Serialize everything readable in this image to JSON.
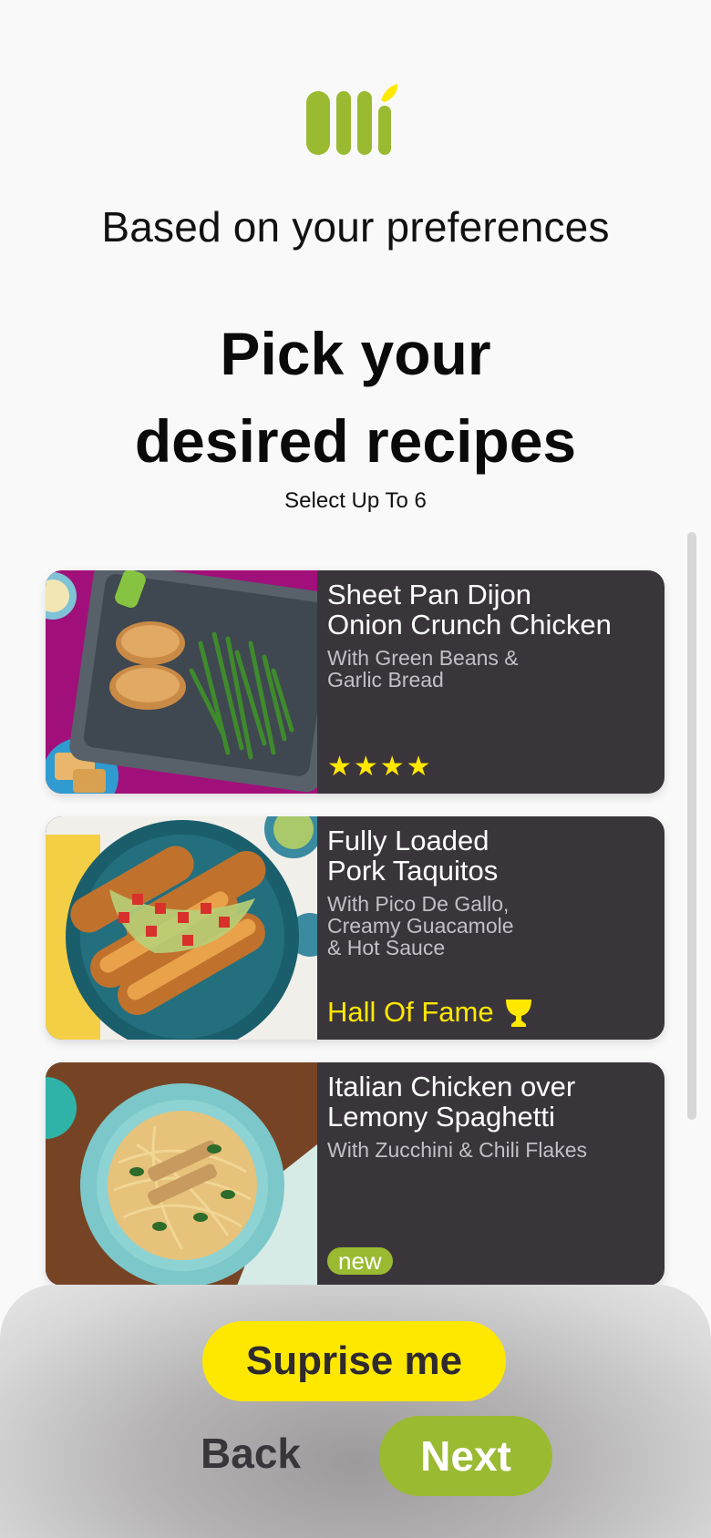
{
  "header": {
    "subtitle": "Based on your preferences",
    "title_line1": "Pick your",
    "title_line2": "desired recipes",
    "hint": "Select Up To 6"
  },
  "recipes": [
    {
      "name": "Sheet Pan Dijon\nOnion Crunch Chicken",
      "description": "With Green Beans &\nGarlic Bread",
      "rating": "★★★★",
      "image_icon": "sheet-pan-chicken-photo"
    },
    {
      "name": "Fully Loaded\nPork Taquitos",
      "description": "With Pico De Gallo,\nCreamy Guacamole\n& Hot Sauce",
      "tag": "Hall Of Fame",
      "tag_icon": "trophy-icon",
      "image_icon": "taquitos-photo"
    },
    {
      "name": "Italian Chicken over\nLemony Spaghetti",
      "description": "With Zucchini & Chili Flakes",
      "badge": "new",
      "image_icon": "spaghetti-photo"
    }
  ],
  "actions": {
    "surprise_label": "Suprise me",
    "back_label": "Back",
    "next_label": "Next"
  },
  "colors": {
    "brand_green": "#9aba32",
    "accent_yellow": "#ffe800",
    "card_bg": "#3a353b"
  }
}
